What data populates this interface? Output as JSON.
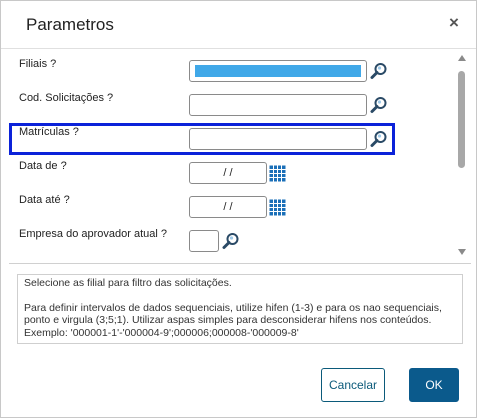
{
  "dialog": {
    "title": "Parametros",
    "close_icon": "close-icon"
  },
  "fields": [
    {
      "label": "Filiais ?",
      "value": "",
      "state": "filled-selection",
      "icon": "search-lookup-icon"
    },
    {
      "label": "Cod. Solicitações ?",
      "value": "",
      "icon": "search-lookup-icon"
    },
    {
      "label": "Matrículas ?",
      "value": "",
      "icon": "search-lookup-icon",
      "highlighted": true
    },
    {
      "label": "Data de ?",
      "value": "/ /",
      "icon": "calendar-icon"
    },
    {
      "label": "Data até ?",
      "value": "/ /",
      "icon": "calendar-icon"
    },
    {
      "label": "Empresa do aprovador atual ?",
      "value": "",
      "icon": "search-lookup-icon"
    }
  ],
  "help": {
    "line1": "Selecione as filial para filtro das solicitações.",
    "line2": "Para definir intervalos de dados sequenciais, utilize hifen (1-3) e para os nao sequenciais, ponto e virgula (3;5;1). Utilizar aspas simples para desconsiderar hifens nos conteúdos. Exemplo: '000001-1'-'000004-9';000006;000008-'000009-8'"
  },
  "buttons": {
    "cancel": "Cancelar",
    "ok": "OK"
  },
  "colors": {
    "highlight_border": "#0b22d9",
    "selection_fill": "#40a8e8",
    "primary_button": "#0b5a8c",
    "calendar_icon": "#1a6fb8"
  }
}
